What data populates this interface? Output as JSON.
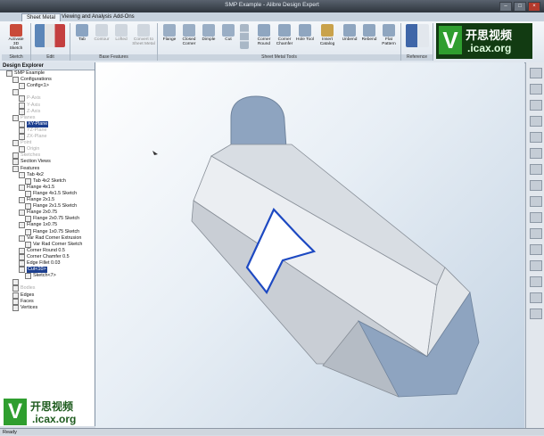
{
  "window": {
    "title": "SMP Example - Alibre Design Expert"
  },
  "tabs": [
    {
      "label": "Sheet Metal",
      "active": true
    },
    {
      "label": "Viewing and Analysis",
      "active": false
    },
    {
      "label": "Add-Ons",
      "active": false
    }
  ],
  "ribbon": {
    "groups": [
      {
        "label": "Sketch",
        "buttons": [
          {
            "label": "Activate 3D Sketch",
            "icon": "sketch-icon"
          }
        ]
      },
      {
        "label": "Edit",
        "buttons": [
          {
            "label": "",
            "icon": "edit-icon"
          }
        ]
      },
      {
        "label": "Base Features",
        "buttons": [
          {
            "label": "Tab",
            "icon": "tab-icon",
            "dim": false
          },
          {
            "label": "Contour",
            "icon": "contour-icon",
            "dim": true
          },
          {
            "label": "Lofted",
            "icon": "lofted-icon",
            "dim": true
          },
          {
            "label": "Convert to Sheet Metal",
            "icon": "convert-icon",
            "dim": true
          }
        ]
      },
      {
        "label": "Sheet Metal Tools",
        "buttons": [
          {
            "label": "Flange",
            "icon": "flange-icon"
          },
          {
            "label": "Closed Corner",
            "icon": "closed-corner-icon"
          },
          {
            "label": "Dimple",
            "icon": "dimple-icon"
          },
          {
            "label": "Cut",
            "icon": "cut-icon"
          },
          {
            "label": "",
            "icon": "misc-icon"
          },
          {
            "label": "Corner Round",
            "icon": "corner-round-icon"
          },
          {
            "label": "Corner Chamfer",
            "icon": "corner-chamfer-icon"
          },
          {
            "label": "Hole Tool",
            "icon": "hole-tool-icon"
          },
          {
            "label": "Insert Catalog",
            "icon": "catalog-icon"
          },
          {
            "label": "Unbend",
            "icon": "unbend-icon"
          },
          {
            "label": "Rebend",
            "icon": "rebend-icon"
          },
          {
            "label": "Flat Pattern",
            "icon": "flat-pattern-icon"
          }
        ]
      },
      {
        "label": "Reference",
        "buttons": [
          {
            "label": "",
            "icon": "reference-icon"
          }
        ]
      }
    ]
  },
  "explorer": {
    "title": "Design Explorer",
    "nodes": [
      {
        "label": "SMP Example",
        "indent": 1
      },
      {
        "label": "Configurations",
        "indent": 2
      },
      {
        "label": "Config<1>",
        "indent": 3
      },
      {
        "label": "",
        "indent": 2
      },
      {
        "label": "P-Axis",
        "indent": 3,
        "dim": true
      },
      {
        "label": "Y-Axis",
        "indent": 3,
        "dim": true
      },
      {
        "label": "Z-Axis",
        "indent": 3,
        "dim": true
      },
      {
        "label": "Planes",
        "indent": 2,
        "dim": true
      },
      {
        "label": "XY-Plane",
        "indent": 3,
        "hl": true
      },
      {
        "label": "YZ-Plane",
        "indent": 3,
        "dim": true
      },
      {
        "label": "ZX-Plane",
        "indent": 3,
        "dim": true
      },
      {
        "label": "Point",
        "indent": 2,
        "dim": true
      },
      {
        "label": "Origin",
        "indent": 3,
        "dim": true
      },
      {
        "label": "Sketches",
        "indent": 2,
        "dim": true
      },
      {
        "label": "Section Views",
        "indent": 2
      },
      {
        "label": "Features",
        "indent": 2
      },
      {
        "label": "Tab 4x2",
        "indent": 3
      },
      {
        "label": "Tab 4x2 Sketch",
        "indent": 4
      },
      {
        "label": "Flange 4x1.5",
        "indent": 3
      },
      {
        "label": "Flange 4x1.5 Sketch",
        "indent": 4
      },
      {
        "label": "Flange 2x1.5",
        "indent": 3
      },
      {
        "label": "Flange 2x1.5 Sketch",
        "indent": 4
      },
      {
        "label": "Flange 2x0.75",
        "indent": 3
      },
      {
        "label": "Flange 2x0.75 Sketch",
        "indent": 4
      },
      {
        "label": "Flange 1x0.75",
        "indent": 3
      },
      {
        "label": "Flange 1x0.75 Sketch",
        "indent": 4
      },
      {
        "label": "Var Rad Corner Extrusion",
        "indent": 3
      },
      {
        "label": "Var Rad Corner Sketch",
        "indent": 4
      },
      {
        "label": "Corner Round 0.5",
        "indent": 3
      },
      {
        "label": "Corner Chamfer 0.5",
        "indent": 3
      },
      {
        "label": "Edge Fillet 0.03",
        "indent": 3
      },
      {
        "label": "Cut<10>",
        "indent": 3,
        "hl": true
      },
      {
        "label": "Sketch<7>",
        "indent": 4
      },
      {
        "label": "",
        "indent": 2
      },
      {
        "label": "Bodies",
        "indent": 2,
        "dim": true
      },
      {
        "label": "Edges",
        "indent": 2
      },
      {
        "label": "Faces",
        "indent": 2
      },
      {
        "label": "Vertices",
        "indent": 2
      }
    ]
  },
  "statusbar": {
    "text": "Ready"
  },
  "watermarks": {
    "cn": "开思视频",
    "domain": ".icax.org",
    "v": "V"
  }
}
